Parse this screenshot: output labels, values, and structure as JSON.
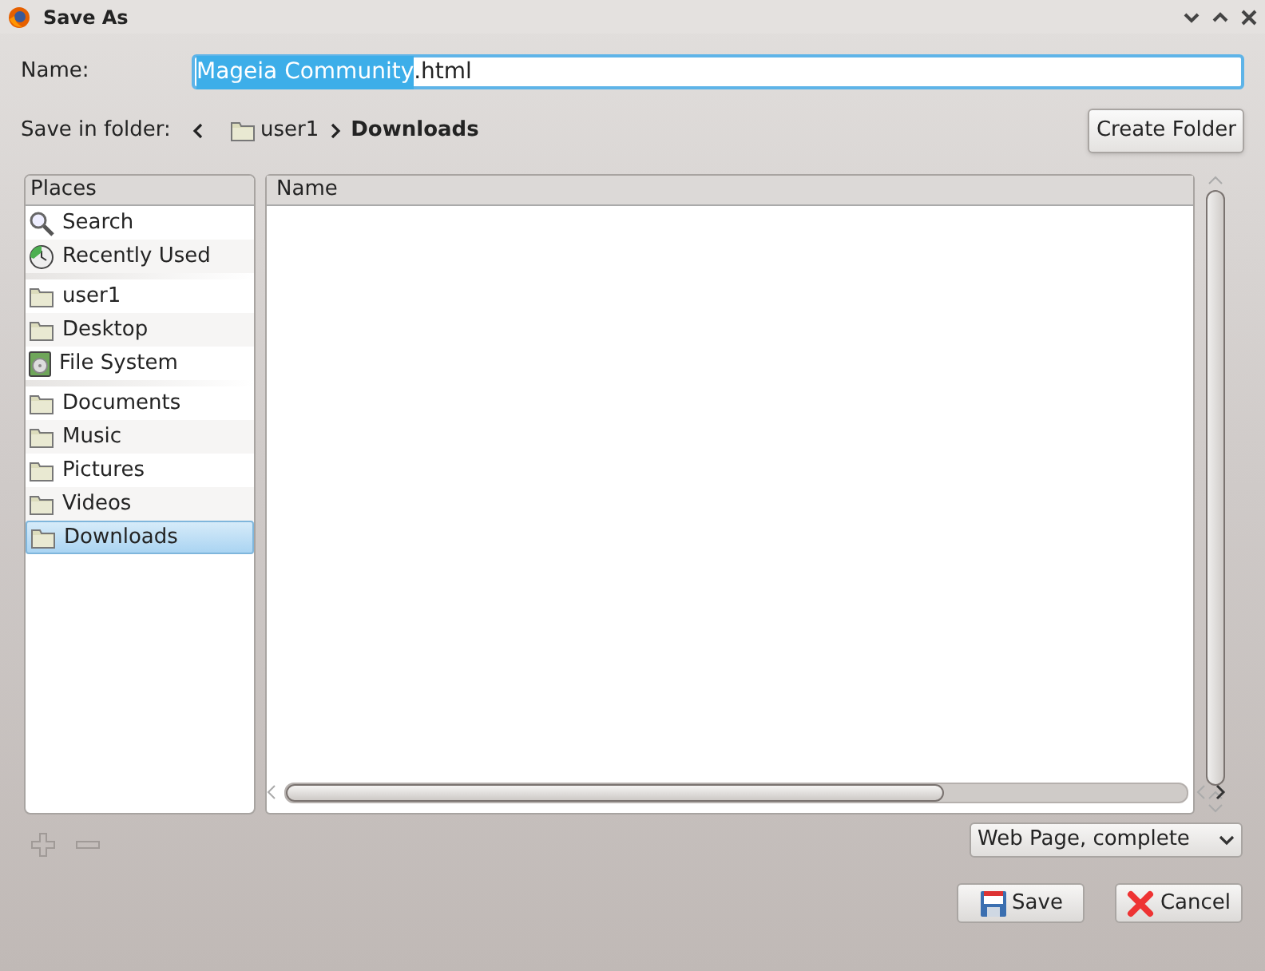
{
  "window": {
    "title": "Save As"
  },
  "name_field": {
    "label": "Name:",
    "selected_text": "Mageia Community",
    "rest_text": ".html"
  },
  "folder": {
    "label": "Save in folder:",
    "path": [
      {
        "label": "user1",
        "current": false
      },
      {
        "label": "Downloads",
        "current": true
      }
    ],
    "create_button": "Create Folder"
  },
  "places": {
    "heading": "Places",
    "groups": [
      [
        {
          "label": "Search",
          "kind": "search",
          "selected": false
        },
        {
          "label": "Recently Used",
          "kind": "recent",
          "selected": false
        }
      ],
      [
        {
          "label": "user1",
          "kind": "folder",
          "selected": false
        },
        {
          "label": "Desktop",
          "kind": "folder",
          "selected": false
        },
        {
          "label": "File System",
          "kind": "drive",
          "selected": false
        }
      ],
      [
        {
          "label": "Documents",
          "kind": "folder",
          "selected": false
        },
        {
          "label": "Music",
          "kind": "folder",
          "selected": false
        },
        {
          "label": "Pictures",
          "kind": "folder",
          "selected": false
        },
        {
          "label": "Videos",
          "kind": "folder",
          "selected": false
        },
        {
          "label": "Downloads",
          "kind": "folder",
          "selected": true
        }
      ]
    ]
  },
  "files": {
    "columns": [
      "Name"
    ]
  },
  "file_type": "Web Page, complete",
  "buttons": [
    {
      "label": "Save",
      "kind": "save"
    },
    {
      "label": "Cancel",
      "kind": "cancel"
    }
  ]
}
